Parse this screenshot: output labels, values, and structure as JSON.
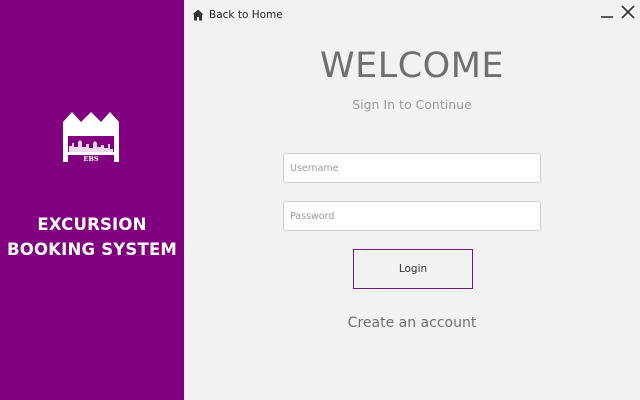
{
  "colors": {
    "sidebar": "#800080",
    "background": "#f2f2f2",
    "accent": "#6a1b7a"
  },
  "sidebar": {
    "logo": {
      "icon": "ebs-logo-icon",
      "text": "EBS"
    },
    "brand_line1": "EXCURSION",
    "brand_line2": "BOOKING SYSTEM"
  },
  "nav": {
    "back_icon": "home-icon",
    "back_label": "Back to Home"
  },
  "window": {
    "minimize_icon": "minimize-icon",
    "close_icon": "close-icon"
  },
  "login": {
    "title": "WELCOME",
    "subtitle": "Sign In to Continue",
    "username_placeholder": "Username",
    "password_placeholder": "Password",
    "login_label": "Login",
    "create_account_label": "Create an account"
  }
}
